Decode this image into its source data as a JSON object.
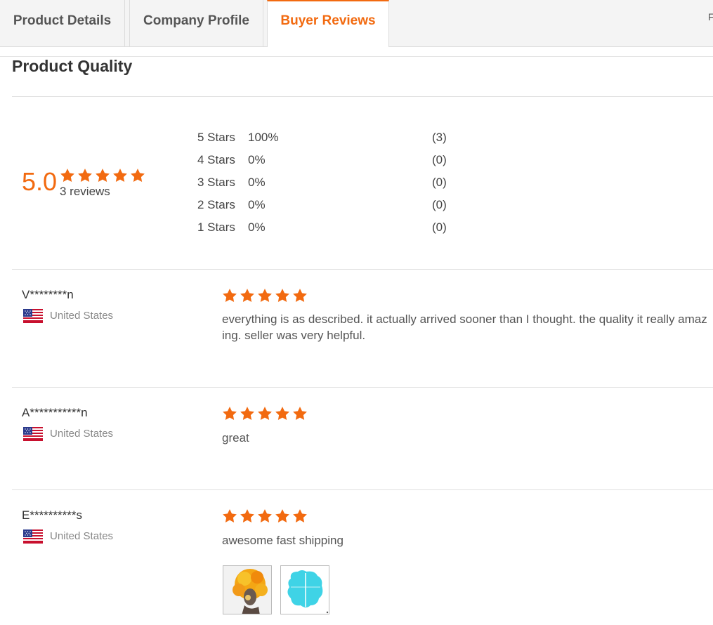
{
  "tabs": [
    {
      "label": "Product Details"
    },
    {
      "label": "Company Profile"
    },
    {
      "label": "Buyer Reviews",
      "active": true
    }
  ],
  "tab_right_fragment": "F",
  "section_title": "Product Quality",
  "summary": {
    "score": "5.0",
    "stars": 5,
    "reviews_count": "3 reviews"
  },
  "distribution": [
    {
      "label": "5  Stars",
      "percent": "100%",
      "count": "(3)"
    },
    {
      "label": "4  Stars",
      "percent": "0%",
      "count": "(0)"
    },
    {
      "label": "3  Stars",
      "percent": "0%",
      "count": "(0)"
    },
    {
      "label": "2  Stars",
      "percent": "0%",
      "count": "(0)"
    },
    {
      "label": "1  Stars",
      "percent": "0%",
      "count": "(0)"
    }
  ],
  "reviews": [
    {
      "reviewer": "V********n",
      "country": "United States",
      "flag_icon": "us-flag-icon",
      "rating": 5,
      "text": "everything is as described. it actually arrived sooner than I thought. the quality it really amaz ing. seller was very helpful.",
      "text_line1": "everything is as described. it actually arrived sooner than I thought. the quality it really amaz",
      "text_line2": "ing. seller was very helpful."
    },
    {
      "reviewer": "A***********n",
      "country": "United States",
      "flag_icon": "us-flag-icon",
      "rating": 5,
      "text": "great"
    },
    {
      "reviewer": "E**********s",
      "country": "United States",
      "flag_icon": "us-flag-icon",
      "rating": 5,
      "text": "awesome fast shipping",
      "photos": [
        "review-photo-1",
        "review-photo-2"
      ]
    }
  ],
  "colors": {
    "accent": "#f26a10",
    "star": "#f26a10"
  }
}
